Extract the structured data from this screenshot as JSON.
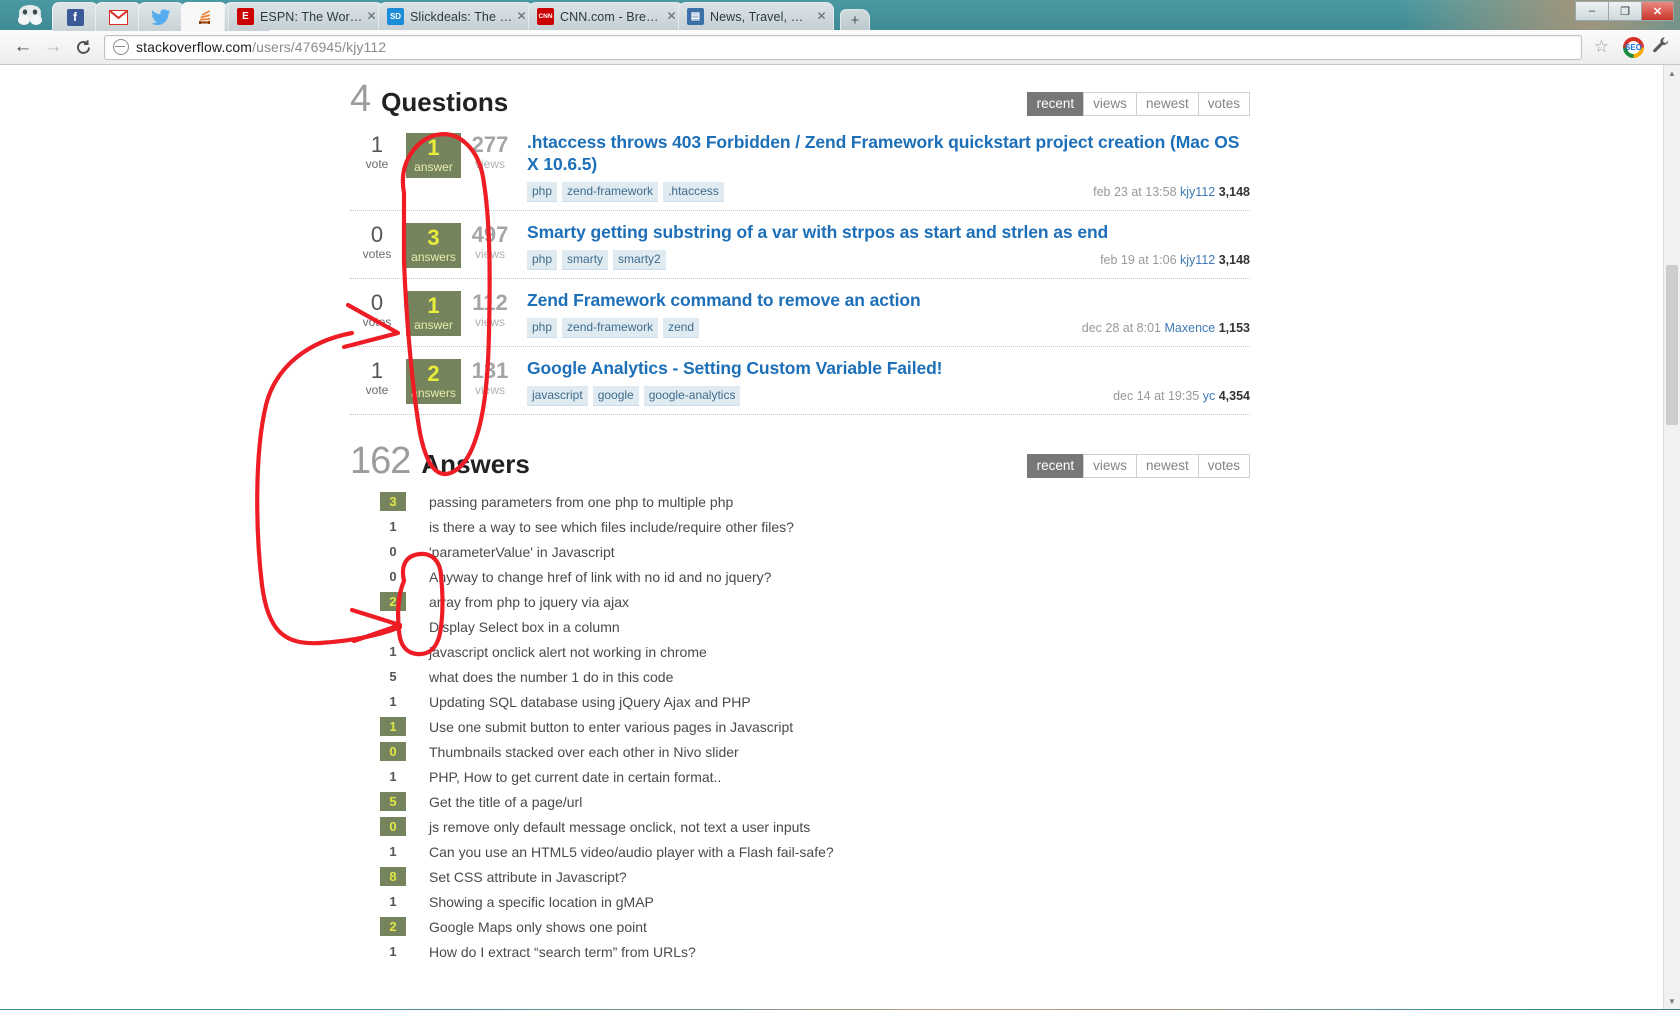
{
  "browser": {
    "window_controls": {
      "minimize": "–",
      "maximize": "❐",
      "close": "✕"
    },
    "pinned_tabs": [
      {
        "name": "facebook-pinned-tab",
        "glyph": "f",
        "color": "#3b5998"
      },
      {
        "name": "gmail-pinned-tab",
        "glyph": "M",
        "color": "#d93025"
      },
      {
        "name": "twitter-pinned-tab",
        "glyph": "ᵧ",
        "color": "#55acee"
      },
      {
        "name": "stackoverflow-pinned-tab",
        "glyph": "≣",
        "color": "#f48024"
      },
      {
        "name": "cloud-pinned-tab",
        "glyph": "☁",
        "color": "#2f7fb8"
      }
    ],
    "tabs": [
      {
        "title": "ESPN: The Worldwide Le...",
        "favicon": "E",
        "favicon_color": "#cc0000",
        "close": "✕"
      },
      {
        "title": "Slickdeals: The Best Deals...",
        "favicon": "SD",
        "favicon_color": "#1a8cd8",
        "close": "✕"
      },
      {
        "title": "CNN.com - Breaking Ne...",
        "favicon": "CNN",
        "favicon_color": "#cc0000",
        "close": "✕"
      },
      {
        "title": "News, Travel, Weather, E...",
        "favicon": "▤",
        "favicon_color": "#3b6fa8",
        "close": "✕"
      }
    ],
    "new_tab_label": "+",
    "nav": {
      "back": "←",
      "forward": "→",
      "reload": "C"
    },
    "omnibox": {
      "host": "stackoverflow.com",
      "path": "/users/476945/kjy112",
      "star": "☆",
      "seo_label": "SEO",
      "wrench": "⚒"
    }
  },
  "questions_section": {
    "count": "4",
    "label": "Questions",
    "sorts": [
      {
        "label": "recent",
        "active": true
      },
      {
        "label": "views",
        "active": false
      },
      {
        "label": "newest",
        "active": false
      },
      {
        "label": "votes",
        "active": false
      }
    ],
    "items": [
      {
        "votes": "1",
        "votes_label": "vote",
        "answers": "1",
        "answers_label": "answer",
        "views": "277",
        "views_label": "views",
        "title": ".htaccess throws 403 Forbidden / Zend Framework quickstart project creation (Mac OS X 10.6.5)",
        "tags": [
          "php",
          "zend-framework",
          ".htaccess"
        ],
        "date": "feb 23 at 13:58",
        "user": "kjy112",
        "rep": "3,148"
      },
      {
        "votes": "0",
        "votes_label": "votes",
        "answers": "3",
        "answers_label": "answers",
        "views": "497",
        "views_label": "views",
        "title": "Smarty getting substring of a var with strpos as start and strlen as end",
        "tags": [
          "php",
          "smarty",
          "smarty2"
        ],
        "date": "feb 19 at 1:06",
        "user": "kjy112",
        "rep": "3,148"
      },
      {
        "votes": "0",
        "votes_label": "votes",
        "answers": "1",
        "answers_label": "answer",
        "views": "112",
        "views_label": "views",
        "title": "Zend Framework command to remove an action",
        "tags": [
          "php",
          "zend-framework",
          "zend"
        ],
        "date": "dec 28 at 8:01",
        "user": "Maxence",
        "rep": "1,153"
      },
      {
        "votes": "1",
        "votes_label": "vote",
        "answers": "2",
        "answers_label": "answers",
        "views": "131",
        "views_label": "views",
        "title": "Google Analytics - Setting Custom Variable Failed!",
        "tags": [
          "javascript",
          "google",
          "google-analytics"
        ],
        "date": "dec 14 at 19:35",
        "user": "yc",
        "rep": "4,354"
      }
    ]
  },
  "answers_section": {
    "count": "162",
    "label": "Answers",
    "sorts": [
      {
        "label": "recent",
        "active": true
      },
      {
        "label": "views",
        "active": false
      },
      {
        "label": "newest",
        "active": false
      },
      {
        "label": "votes",
        "active": false
      }
    ],
    "items": [
      {
        "score": "3",
        "accepted": true,
        "title": "passing parameters from one php to multiple php"
      },
      {
        "score": "1",
        "accepted": false,
        "title": "is there a way to see which files include/require other files?"
      },
      {
        "score": "0",
        "accepted": false,
        "title": "'parameterValue' in Javascript"
      },
      {
        "score": "0",
        "accepted": false,
        "title": "Anyway to change href of link with no id and no jquery?"
      },
      {
        "score": "2",
        "accepted": true,
        "title": "array from php to jquery via ajax"
      },
      {
        "score": "1",
        "accepted": false,
        "title": "Display Select box in a column"
      },
      {
        "score": "1",
        "accepted": false,
        "title": "javascript onclick alert not working in chrome"
      },
      {
        "score": "5",
        "accepted": false,
        "title": "what does the number 1 do in this code"
      },
      {
        "score": "1",
        "accepted": false,
        "title": "Updating SQL database using jQuery Ajax and PHP"
      },
      {
        "score": "1",
        "accepted": true,
        "title": "Use one submit button to enter various pages in Javascript"
      },
      {
        "score": "0",
        "accepted": true,
        "title": "Thumbnails stacked over each other in Nivo slider"
      },
      {
        "score": "1",
        "accepted": false,
        "title": "PHP, How to get current date in certain format.."
      },
      {
        "score": "5",
        "accepted": true,
        "title": "Get the title of a page/url"
      },
      {
        "score": "0",
        "accepted": true,
        "title": "js remove only default message onclick, not text a user inputs"
      },
      {
        "score": "1",
        "accepted": false,
        "title": "Can you use an HTML5 video/audio player with a Flash fail-safe?"
      },
      {
        "score": "8",
        "accepted": true,
        "title": "Set CSS attribute in Javascript?"
      },
      {
        "score": "1",
        "accepted": false,
        "title": "Showing a specific location in gMAP"
      },
      {
        "score": "2",
        "accepted": true,
        "title": "Google Maps only shows one point"
      },
      {
        "score": "1",
        "accepted": false,
        "title": "How do I extract “search term” from URLs?"
      }
    ]
  },
  "annotation": {
    "color": "#ee1c25",
    "description": "hand-drawn red circles around question vote column and answer score column, joined by an arrow"
  },
  "scrollbar": {
    "up": "▲",
    "down": "▼"
  }
}
